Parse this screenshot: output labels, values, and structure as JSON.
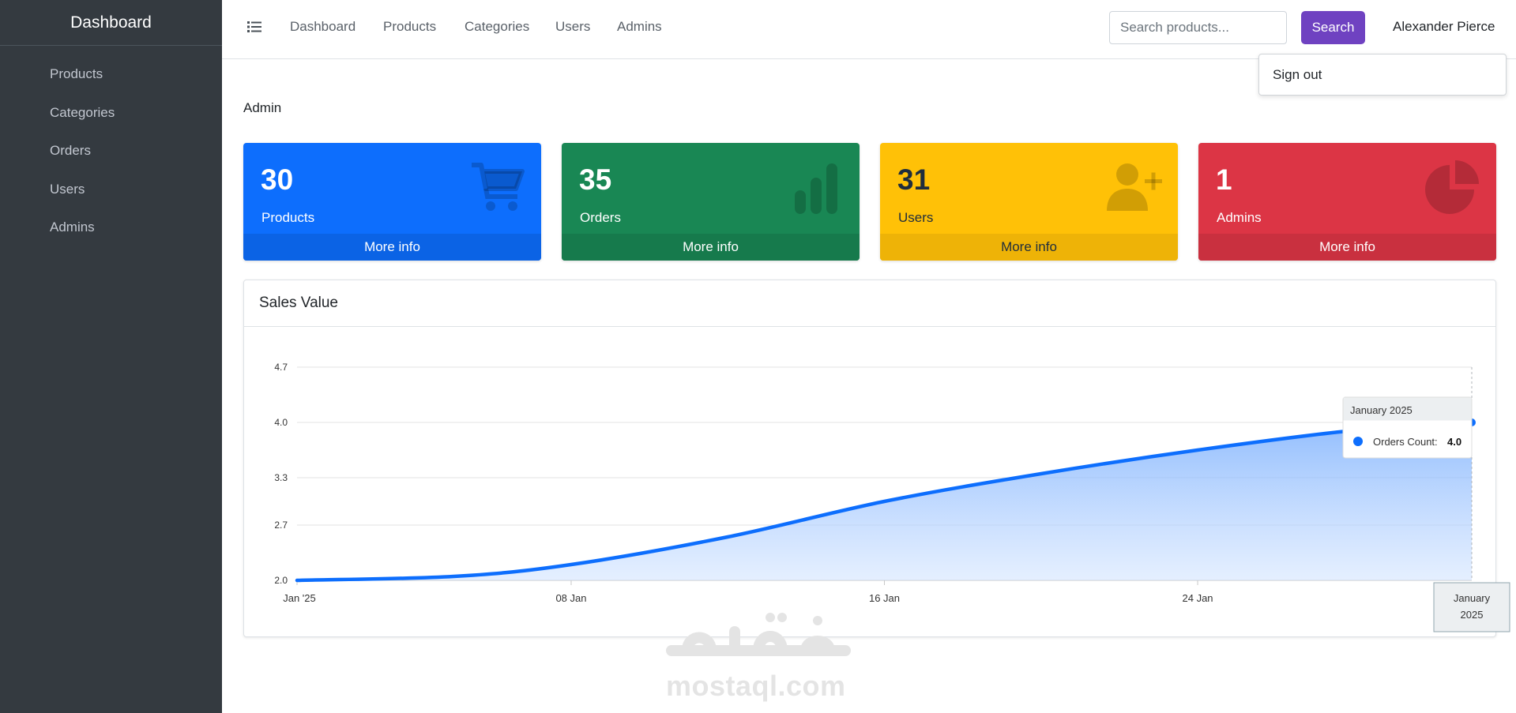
{
  "sidebar": {
    "brand": "Dashboard",
    "items": [
      {
        "label": "Products"
      },
      {
        "label": "Categories"
      },
      {
        "label": "Orders"
      },
      {
        "label": "Users"
      },
      {
        "label": "Admins"
      }
    ]
  },
  "topbar": {
    "links": [
      {
        "label": "Dashboard"
      },
      {
        "label": "Products"
      },
      {
        "label": "Categories"
      },
      {
        "label": "Users"
      },
      {
        "label": "Admins"
      }
    ],
    "search": {
      "placeholder": "Search products...",
      "value": ""
    },
    "search_button": "Search",
    "user_name": "Alexander Pierce",
    "dropdown": {
      "sign_out": "Sign out"
    }
  },
  "page": {
    "heading": "Admin"
  },
  "stats": [
    {
      "number": "30",
      "label": "Products",
      "more": "More info",
      "color": "#0d6efd",
      "icon": "cart-icon"
    },
    {
      "number": "35",
      "label": "Orders",
      "more": "More info",
      "color": "#198754",
      "icon": "bar-chart-icon"
    },
    {
      "number": "31",
      "label": "Users",
      "more": "More info",
      "color": "#ffc107",
      "icon": "user-plus-icon"
    },
    {
      "number": "1",
      "label": "Admins",
      "more": "More info",
      "color": "#dc3545",
      "icon": "pie-chart-icon"
    }
  ],
  "card": {
    "title": "Sales Value"
  },
  "chart_data": {
    "type": "area",
    "series": [
      {
        "name": "Orders Count",
        "points": [
          {
            "x": "2025-01-01",
            "y": 2.0
          },
          {
            "x": "2025-01-05",
            "y": 2.05
          },
          {
            "x": "2025-01-08",
            "y": 2.2
          },
          {
            "x": "2025-01-12",
            "y": 2.55
          },
          {
            "x": "2025-01-16",
            "y": 3.0
          },
          {
            "x": "2025-01-20",
            "y": 3.35
          },
          {
            "x": "2025-01-24",
            "y": 3.65
          },
          {
            "x": "2025-01-28",
            "y": 3.9
          },
          {
            "x": "2025-01-31",
            "y": 4.0
          }
        ]
      }
    ],
    "y_ticks": [
      "2.0",
      "2.7",
      "3.3",
      "4.0",
      "4.7"
    ],
    "ylim": [
      2.0,
      4.7
    ],
    "x_ticks": [
      {
        "x": "2025-01-01",
        "label": "Jan '25"
      },
      {
        "x": "2025-01-08",
        "label": "08 Jan"
      },
      {
        "x": "2025-01-16",
        "label": "16 Jan"
      },
      {
        "x": "2025-01-24",
        "label": "24 Jan"
      }
    ],
    "xlim": [
      "2025-01-01",
      "2025-01-31"
    ],
    "grid": true,
    "line_color": "#0d6efd",
    "tooltip": {
      "title": "January 2025",
      "series": "Orders Count:",
      "value": "4.0"
    },
    "crosshair_label": [
      "January",
      "2025"
    ]
  },
  "watermark": {
    "text": "mostaql.com"
  }
}
